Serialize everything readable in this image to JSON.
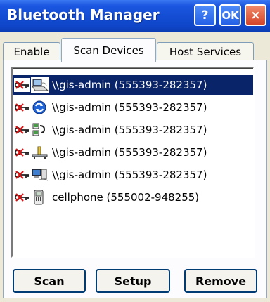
{
  "window": {
    "title": "Bluetooth Manager",
    "help_label": "?",
    "ok_label": "OK",
    "close_label": "×"
  },
  "tabs": [
    {
      "label": "Enable"
    },
    {
      "label": "Scan Devices"
    },
    {
      "label": "Host Services"
    }
  ],
  "devices": [
    {
      "label": "\\\\gis-admin (555393-282357)",
      "icon": "laptop-icon",
      "selected": true
    },
    {
      "label": "\\\\gis-admin (555393-282357)",
      "icon": "sync-icon",
      "selected": false
    },
    {
      "label": "\\\\gis-admin (555393-282357)",
      "icon": "network-devices-icon",
      "selected": false
    },
    {
      "label": "\\\\gis-admin (555393-282357)",
      "icon": "network-icon",
      "selected": false
    },
    {
      "label": "\\\\gis-admin (555393-282357)",
      "icon": "computer-icon",
      "selected": false
    },
    {
      "label": "cellphone (555002-948255)",
      "icon": "phone-icon",
      "selected": false
    }
  ],
  "buttons": {
    "scan": "Scan",
    "setup": "Setup",
    "remove": "Remove"
  },
  "colors": {
    "title_bar": "#0f46c9",
    "selection": "#0a246a"
  }
}
